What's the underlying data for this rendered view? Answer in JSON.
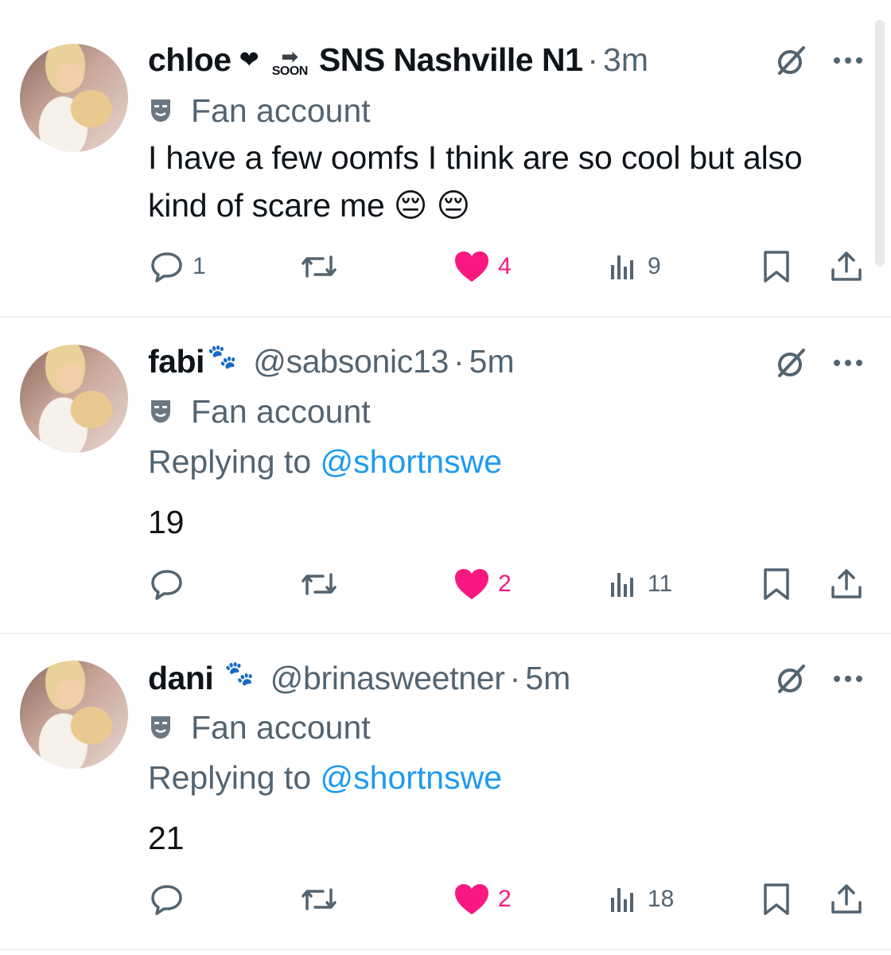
{
  "tweets": [
    {
      "name": "chloe",
      "name_suffix_heart": "❤",
      "soon_label": "SOON",
      "name_tail": "SNS Nashville N1",
      "handle": "",
      "dot": "·",
      "time": "3m",
      "badge_label": "Fan account",
      "replying_prefix": "",
      "replying_handle": "",
      "text": "I have a few oomfs I think are so cool but also kind of scare me 😔 😔",
      "replies": "1",
      "retweets": "",
      "likes": "4",
      "views": "9"
    },
    {
      "name": "fabi",
      "handle": "@sabsonic13",
      "dot": "·",
      "time": "5m",
      "badge_label": "Fan account",
      "replying_prefix": "Replying to ",
      "replying_handle": "@shortnswe",
      "text": "19",
      "replies": "",
      "retweets": "",
      "likes": "2",
      "views": "11"
    },
    {
      "name": "dani",
      "handle": "@brinasweetner",
      "dot": "·",
      "time": "5m",
      "badge_label": "Fan account",
      "replying_prefix": "Replying to ",
      "replying_handle": "@shortnswe",
      "text": "21",
      "replies": "",
      "retweets": "",
      "likes": "2",
      "views": "18"
    }
  ],
  "colors": {
    "text": "#0f1419",
    "muted": "#536471",
    "link": "#1d9bf0",
    "like": "#f91880",
    "divider": "#eff3f4"
  },
  "icons": {
    "reply": "speech-bubble-icon",
    "retweet": "retweet-arrows-icon",
    "like": "heart-icon",
    "views": "bar-chart-icon",
    "bookmark": "bookmark-icon",
    "share": "share-upload-icon",
    "grok": "grok-slash-icon",
    "more": "ellipsis-icon",
    "badge": "theater-mask-icon",
    "paws": "paw-prints-icon"
  }
}
